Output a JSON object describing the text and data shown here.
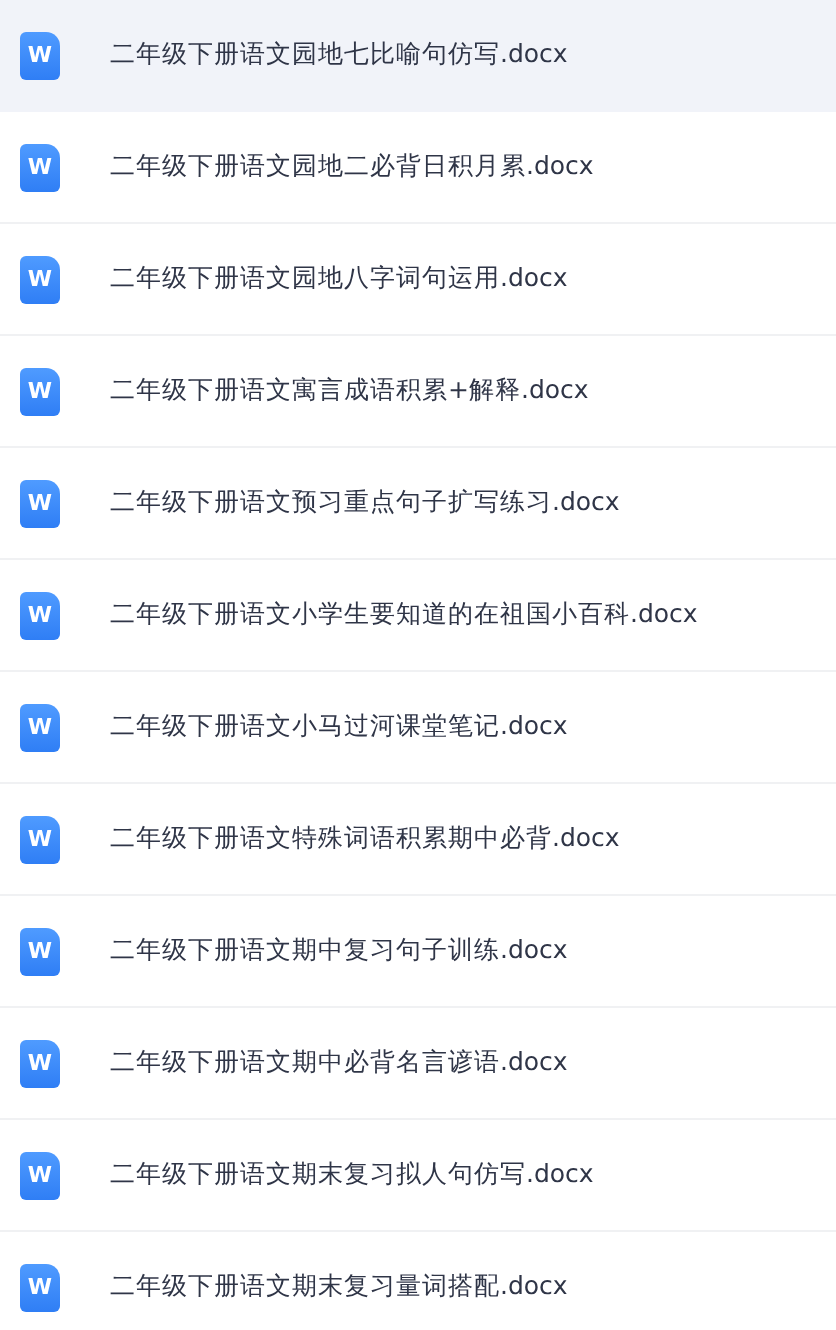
{
  "files": [
    {
      "name": "二年级下册语文园地七比喻句仿写.docx",
      "icon": "W",
      "selected": true
    },
    {
      "name": "二年级下册语文园地二必背日积月累.docx",
      "icon": "W",
      "selected": false
    },
    {
      "name": "二年级下册语文园地八字词句运用.docx",
      "icon": "W",
      "selected": false
    },
    {
      "name": "二年级下册语文寓言成语积累+解释.docx",
      "icon": "W",
      "selected": false
    },
    {
      "name": "二年级下册语文预习重点句子扩写练习.docx",
      "icon": "W",
      "selected": false
    },
    {
      "name": "二年级下册语文小学生要知道的在祖国小百科.docx",
      "icon": "W",
      "selected": false
    },
    {
      "name": "二年级下册语文小马过河课堂笔记.docx",
      "icon": "W",
      "selected": false
    },
    {
      "name": "二年级下册语文特殊词语积累期中必背.docx",
      "icon": "W",
      "selected": false
    },
    {
      "name": "二年级下册语文期中复习句子训练.docx",
      "icon": "W",
      "selected": false
    },
    {
      "name": "二年级下册语文期中必背名言谚语.docx",
      "icon": "W",
      "selected": false
    },
    {
      "name": "二年级下册语文期末复习拟人句仿写.docx",
      "icon": "W",
      "selected": false
    },
    {
      "name": "二年级下册语文期末复习量词搭配.docx",
      "icon": "W",
      "selected": false
    }
  ]
}
